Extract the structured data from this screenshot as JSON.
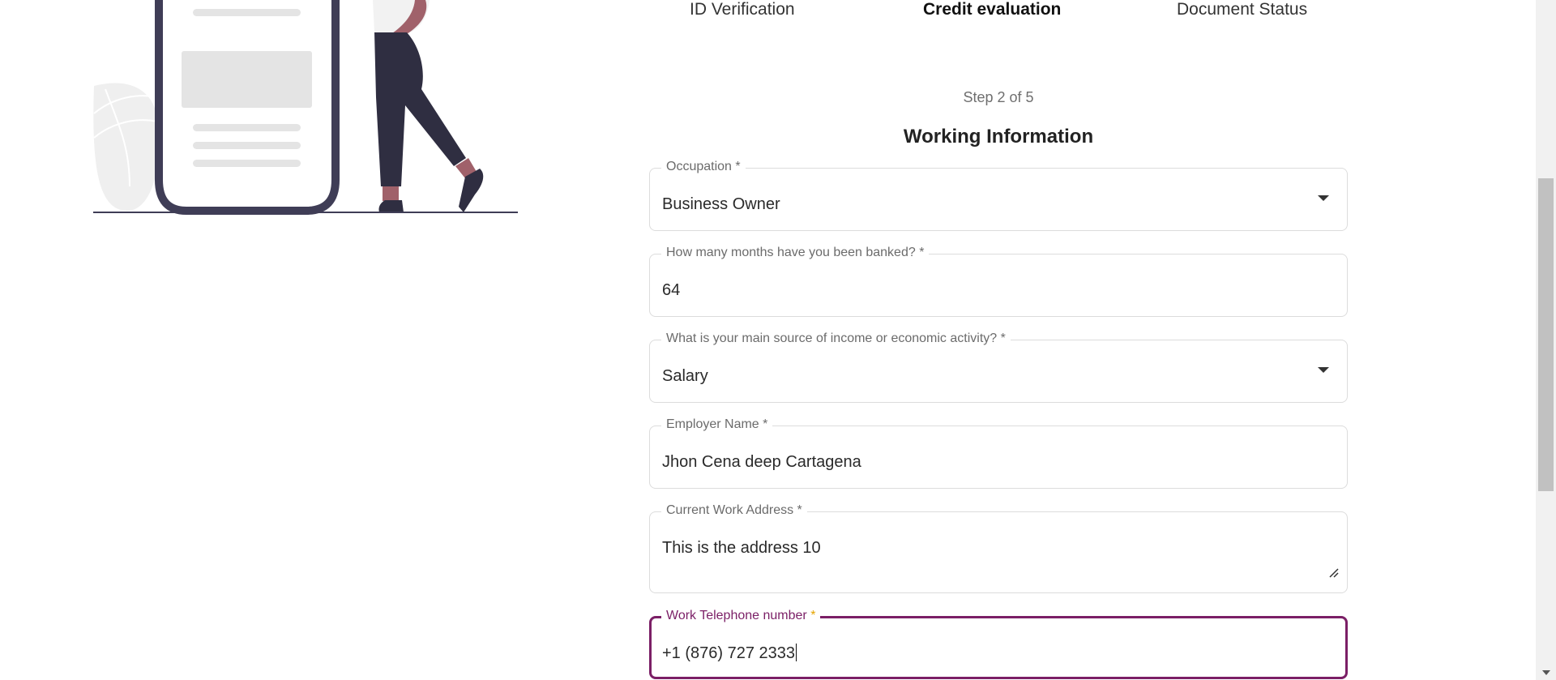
{
  "stepper": {
    "tabs": [
      {
        "label": "ID Verification"
      },
      {
        "label": "Credit evaluation",
        "active": true
      },
      {
        "label": "Document Status"
      }
    ],
    "counter": "Step 2 of 5"
  },
  "form": {
    "title": "Working Information",
    "occupation": {
      "label": "Occupation *",
      "value": "Business Owner"
    },
    "months_banked": {
      "label": "How many months have you been banked? *",
      "value": "64"
    },
    "income_source": {
      "label": "What is your main source of income or economic activity? *",
      "value": "Salary"
    },
    "employer_name": {
      "label": "Employer Name *",
      "value": "Jhon Cena deep Cartagena"
    },
    "work_address": {
      "label": "Current Work Address *",
      "value": "This is the address 10"
    },
    "work_phone": {
      "label": "Work Telephone number",
      "required_mark": "*",
      "value": "+1 (876) 727 2333"
    }
  },
  "colors": {
    "accent": "#7b1f66",
    "required_star": "#e6a500",
    "illustration_dark": "#3f3d56"
  },
  "icons": {
    "dropdown": "chevron-down-icon",
    "resize": "resize-handle-icon"
  }
}
